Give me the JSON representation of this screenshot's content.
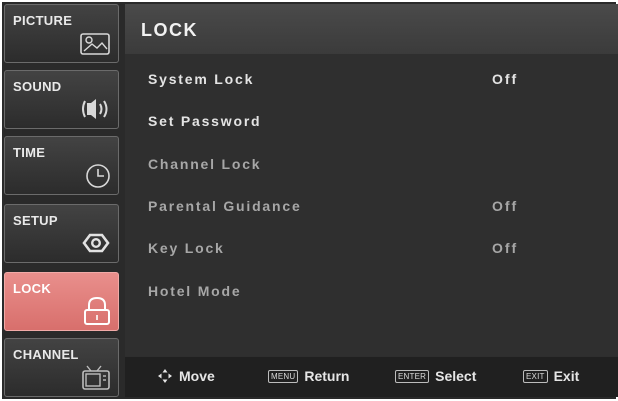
{
  "sidebar": {
    "tabs": [
      {
        "label": "PICTURE",
        "icon": "picture-icon",
        "active": false
      },
      {
        "label": "SOUND",
        "icon": "speaker-icon",
        "active": false
      },
      {
        "label": "TIME",
        "icon": "clock-icon",
        "active": false
      },
      {
        "label": "SETUP",
        "icon": "settings-icon",
        "active": false
      },
      {
        "label": "LOCK",
        "icon": "lock-icon",
        "active": true
      },
      {
        "label": "CHANNEL",
        "icon": "tv-icon",
        "active": false
      }
    ]
  },
  "main": {
    "title": "LOCK",
    "items": [
      {
        "label": "System Lock",
        "value": "Off"
      },
      {
        "label": "Set Password",
        "value": ""
      },
      {
        "label": "Channel Lock",
        "value": ""
      },
      {
        "label": "Parental Guidance",
        "value": "Off"
      },
      {
        "label": "Key Lock",
        "value": "Off"
      },
      {
        "label": "Hotel Mode",
        "value": ""
      }
    ]
  },
  "footer": {
    "move_label": "Move",
    "return_key": "MENU",
    "return_label": "Return",
    "select_key": "ENTER",
    "select_label": "Select",
    "exit_key": "EXIT",
    "exit_label": "Exit"
  },
  "colors": {
    "active_tab": "#e07c79",
    "background": "#2e2e2e"
  }
}
